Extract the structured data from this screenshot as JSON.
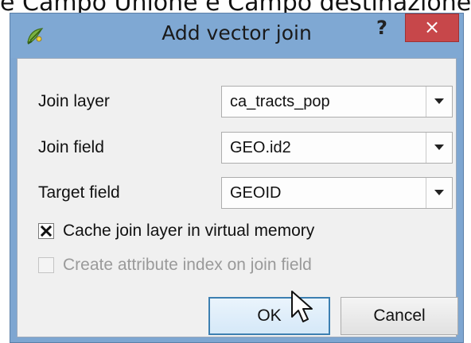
{
  "background_caption": "e Campo Unione e Campo destinazione",
  "window": {
    "title": "Add vector join",
    "help_label": "?",
    "close_label": "×"
  },
  "form": {
    "join_layer": {
      "label": "Join layer",
      "value": "ca_tracts_pop"
    },
    "join_field": {
      "label": "Join field",
      "value": "GEO.id2"
    },
    "target_field": {
      "label": "Target field",
      "value": "GEOID"
    }
  },
  "options": {
    "cache": {
      "label": "Cache join layer in virtual memory",
      "checked": true
    },
    "index": {
      "label": "Create attribute index on join field",
      "checked": false,
      "enabled": false
    }
  },
  "buttons": {
    "ok": "OK",
    "cancel": "Cancel"
  },
  "colors": {
    "titlebar": "#7fa8d3",
    "close": "#c7474a",
    "dialog_bg": "#f0f0f0",
    "default_button_border": "#3c7fb1"
  }
}
